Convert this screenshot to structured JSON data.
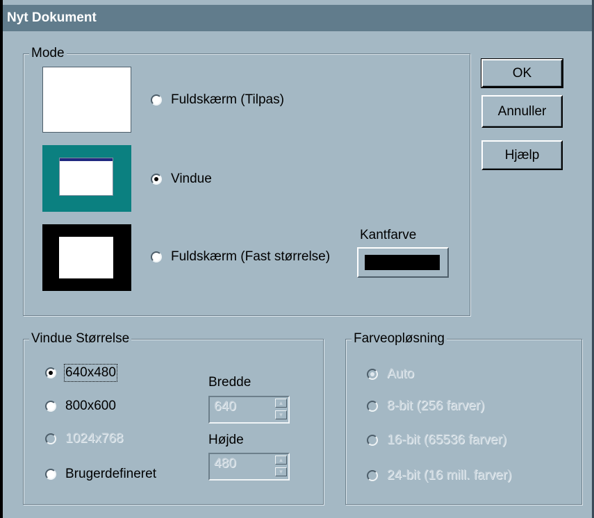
{
  "window": {
    "title": "Nyt Dokument"
  },
  "mode": {
    "label": "Mode",
    "options": [
      "Fuldskærm (Tilpas)",
      "Vindue",
      "Fuldskærm (Fast størrelse)"
    ],
    "selected": "Vindue",
    "border_color_label": "Kantfarve",
    "border_color": "#000000"
  },
  "buttons": {
    "ok": "OK",
    "cancel": "Annuller",
    "help": "Hjælp"
  },
  "window_size": {
    "label": "Vindue Størrelse",
    "options": [
      "640x480",
      "800x600",
      "1024x768",
      "Brugerdefineret"
    ],
    "selected": "640x480",
    "width_label": "Bredde",
    "width_value": "640",
    "height_label": "Højde",
    "height_value": "480"
  },
  "color_resolution": {
    "label": "Farveopløsning",
    "options": [
      "Auto",
      "8-bit (256 farver)",
      "16-bit (65536 farver)",
      "24-bit (16 mill. farver)"
    ],
    "selected": "Auto"
  },
  "colors": {
    "titlebar": "#617c8c",
    "dialog_bg": "#a4b8c4",
    "window_preview": "#0b8080"
  }
}
